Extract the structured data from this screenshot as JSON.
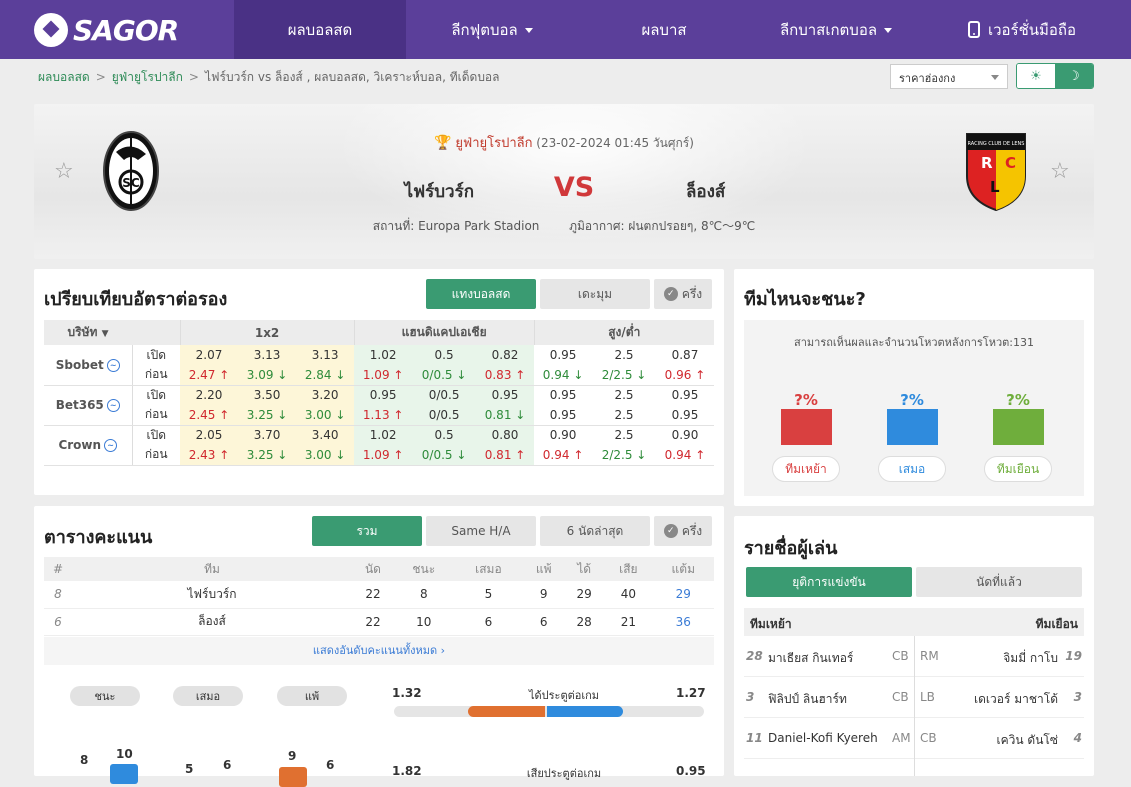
{
  "nav": {
    "logo": "SAGOR",
    "items": [
      {
        "label": "ผลบอลสด",
        "active": true
      },
      {
        "label": "ลีกฟุตบอล",
        "dropdown": true
      },
      {
        "label": "ผลบาส"
      },
      {
        "label": "ลีกบาสเกตบอล",
        "dropdown": true
      },
      {
        "label": "เวอร์ชั่นมือถือ"
      }
    ]
  },
  "breadcrumb": {
    "home": "ผลบอลสด",
    "league": "ยูฟ่ายูโรปาลีก",
    "current": "ไฟร์บวร์ก vs ล็องส์ , ผลบอลสด, วิเคราะห์บอล, ทีเด็ดบอล"
  },
  "odds_type_select": "ราคาฮ่องกง",
  "theme_toggle": {
    "light_icon": "☀",
    "dark_icon": "☽"
  },
  "match": {
    "league": "ยูฟ่ายูโรปาลีก",
    "datetime": "(23-02-2024 01:45 วันศุกร์)",
    "home": "ไฟร์บวร์ก",
    "vs": "VS",
    "away": "ล็องส์",
    "venue": "สถานที่: Europa Park Stadion",
    "weather": "ภูมิอากาศ: ฝนตกปรอยๆ, 8℃～9℃",
    "away_crest_text": "RACING CLUB DE LENS"
  },
  "odds": {
    "title": "เปรียบเทียบอัตราต่อรอง",
    "tabs": [
      "แทงบอลสด",
      "เดะมุม"
    ],
    "half_label": "ครึ่ง",
    "headers": [
      "บริษัท",
      "1x2",
      "แฮนดิแคปเอเชีย",
      "สูง/ต่ำ"
    ],
    "row_labels": [
      "เปิด",
      "ก่อน"
    ],
    "companies": [
      {
        "name": "Sbobet",
        "open": [
          "2.07",
          "3.13",
          "3.13",
          "1.02",
          "0.5",
          "0.82",
          "0.95",
          "2.5",
          "0.87"
        ],
        "live": [
          [
            "2.47",
            "up"
          ],
          [
            "3.09",
            "dn"
          ],
          [
            "2.84",
            "dn"
          ],
          [
            "1.09",
            "up"
          ],
          [
            "0/0.5",
            "dn"
          ],
          [
            "0.83",
            "up"
          ],
          [
            "0.94",
            "dn"
          ],
          [
            "2/2.5",
            "dn"
          ],
          [
            "0.96",
            "up"
          ]
        ]
      },
      {
        "name": "Bet365",
        "open": [
          "2.20",
          "3.50",
          "3.20",
          "0.95",
          "0/0.5",
          "0.95",
          "0.95",
          "2.5",
          "0.95"
        ],
        "live": [
          [
            "2.45",
            "up"
          ],
          [
            "3.25",
            "dn"
          ],
          [
            "3.00",
            "dn"
          ],
          [
            "1.13",
            "up"
          ],
          [
            "0/0.5",
            ""
          ],
          [
            "0.81",
            "dn"
          ],
          [
            "0.95",
            ""
          ],
          [
            "2.5",
            ""
          ],
          [
            "0.95",
            ""
          ]
        ]
      },
      {
        "name": "Crown",
        "open": [
          "2.05",
          "3.70",
          "3.40",
          "1.02",
          "0.5",
          "0.80",
          "0.90",
          "2.5",
          "0.90"
        ],
        "live": [
          [
            "2.43",
            "up"
          ],
          [
            "3.25",
            "dn"
          ],
          [
            "3.00",
            "dn"
          ],
          [
            "1.09",
            "up"
          ],
          [
            "0/0.5",
            "dn"
          ],
          [
            "0.81",
            "up"
          ],
          [
            "0.94",
            "up"
          ],
          [
            "2/2.5",
            "dn"
          ],
          [
            "0.94",
            "up"
          ]
        ]
      }
    ]
  },
  "standings": {
    "title": "ตารางคะแนน",
    "tabs": [
      "รวม",
      "Same H/A",
      "6 นัดล่าสุด"
    ],
    "half_label": "ครึ่ง",
    "headers": [
      "#",
      "ทีม",
      "นัด",
      "ชนะ",
      "เสมอ",
      "แพ้",
      "ได้",
      "เสีย",
      "แต้ม"
    ],
    "rows": [
      [
        "8",
        "ไฟร์บวร์ก",
        "22",
        "8",
        "5",
        "9",
        "29",
        "40",
        "29"
      ],
      [
        "6",
        "ล็องส์",
        "22",
        "10",
        "6",
        "6",
        "28",
        "21",
        "36"
      ]
    ],
    "show_all": "แสดงอันดับคะแนนทั้งหมด",
    "pills": [
      "ชนะ",
      "เสมอ",
      "แพ้"
    ],
    "stat1": {
      "home": "1.32",
      "label": "ได้ประตูต่อเกม",
      "away": "1.27"
    },
    "bars_home": [
      "8",
      "5",
      "9"
    ],
    "bars_away": [
      "10",
      "6",
      "6"
    ],
    "stat2": {
      "home": "1.82",
      "label": "เสียประตูต่อเกม",
      "away": "0.95"
    }
  },
  "prediction": {
    "title": "ทีมไหนจะชนะ?",
    "note": "สามารถเห็นผลและจำนวนโหวตหลังการโหวต:131",
    "options": [
      {
        "pct": "?%",
        "label": "ทีมเหย้า",
        "color": "#d94040"
      },
      {
        "pct": "?%",
        "label": "เสมอ",
        "color": "#2f8bdd"
      },
      {
        "pct": "?%",
        "label": "ทีมเยือน",
        "color": "#6fae3c"
      }
    ]
  },
  "players": {
    "title": "รายชื่อผู้เล่น",
    "tabs": [
      "ยุติการแข่งขัน",
      "นัดที่แล้ว"
    ],
    "home_header": "ทีมเหย้า",
    "away_header": "ทีมเยือน",
    "rows": [
      {
        "hn": "28",
        "hname": "มาเธียส กินเทอร์",
        "hpos": "CB",
        "apos": "RM",
        "aname": "จิมมี่ กาโบ",
        "an": "19"
      },
      {
        "hn": "3",
        "hname": "ฟิลิปป์ ลินฮาร์ท",
        "hpos": "CB",
        "apos": "LB",
        "aname": "เดเวอร์ มาชาโด้",
        "an": "3"
      },
      {
        "hn": "11",
        "hname": "Daniel-Kofi Kyereh",
        "hpos": "AM",
        "apos": "CB",
        "aname": "เควิน ดันโซ่",
        "an": "4"
      }
    ]
  }
}
